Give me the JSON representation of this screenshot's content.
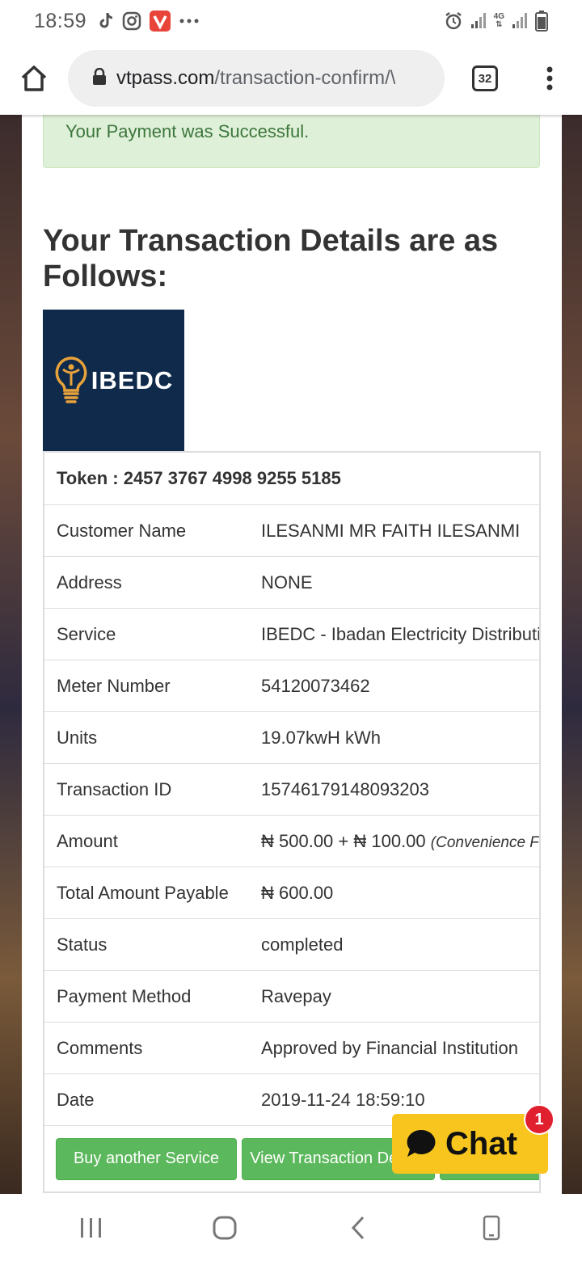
{
  "status_bar": {
    "time": "18:59",
    "network_label": "4G",
    "icons": [
      "tiktok-icon",
      "instagram-icon",
      "vivaldi-icon",
      "more-dots-icon",
      "alarm-icon",
      "signal-icon",
      "signal-4g-icon",
      "battery-icon"
    ]
  },
  "browser": {
    "url_domain": "vtpass.com",
    "url_path": "/transaction-confirm/\\",
    "tab_count": "32"
  },
  "page": {
    "success_message": "Your Payment was Successful.",
    "heading": "Your Transaction Details are as Follows:",
    "provider_logo_text": "IBEDC"
  },
  "details": {
    "token": "Token : 2457 3767 4998 9255 5185",
    "rows": [
      {
        "label": "Customer Name",
        "value": "ILESANMI MR FAITH ILESANMI"
      },
      {
        "label": "Address",
        "value": "NONE"
      },
      {
        "label": "Service",
        "value": "IBEDC - Ibadan Electricity Distribution"
      },
      {
        "label": "Meter Number",
        "value": "54120073462"
      },
      {
        "label": "Units",
        "value": "19.07kwH kWh"
      },
      {
        "label": "Transaction ID",
        "value": "15746179148093203"
      },
      {
        "label": "Amount",
        "value": "₦ 500.00 + ₦ 100.00",
        "note": "(Convenience Fee)"
      },
      {
        "label": "Total Amount Payable",
        "value": "₦ 600.00"
      },
      {
        "label": "Status",
        "value": "completed"
      },
      {
        "label": "Payment Method",
        "value": "Ravepay"
      },
      {
        "label": "Comments",
        "value": "Approved by Financial Institution"
      },
      {
        "label": "Date",
        "value": "2019-11-24 18:59:10"
      }
    ]
  },
  "actions": {
    "buy_another": "Buy another Service",
    "view_transaction": "View Transaction Details"
  },
  "chat": {
    "label": "Chat",
    "badge": "1"
  },
  "colors": {
    "success_bg": "#dff0d8",
    "success_text": "#3c763d",
    "button_green": "#5cb85c",
    "logo_bg": "#0f2a4a",
    "logo_accent": "#e8a23a",
    "chat_yellow": "#f7c51e",
    "badge_red": "#e0202e"
  }
}
